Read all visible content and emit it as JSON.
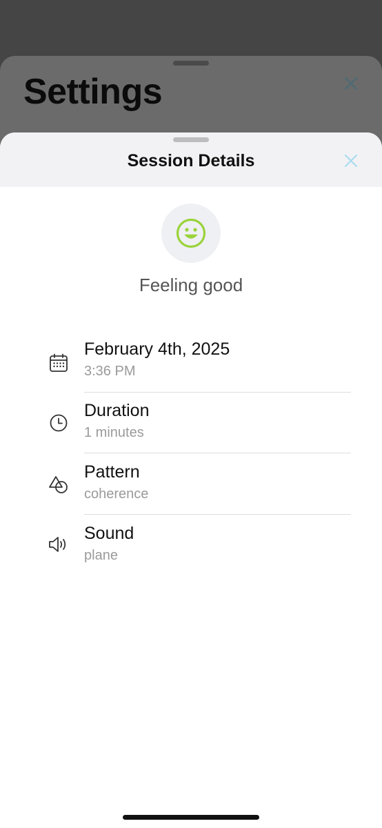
{
  "colors": {
    "accent": "#9ad33a",
    "close_front": "#a8dcef",
    "close_back": "#4b6a74"
  },
  "background_sheet": {
    "title": "Settings",
    "close_icon": "close-icon"
  },
  "session_sheet": {
    "title": "Session Details",
    "close_icon": "close-icon",
    "mood": {
      "icon": "smiley-icon",
      "label": "Feeling good"
    },
    "details": [
      {
        "icon": "calendar-icon",
        "title": "February 4th, 2025",
        "subtitle": "3:36 PM"
      },
      {
        "icon": "clock-icon",
        "title": "Duration",
        "subtitle": "1 minutes"
      },
      {
        "icon": "shapes-icon",
        "title": "Pattern",
        "subtitle": "coherence"
      },
      {
        "icon": "speaker-icon",
        "title": "Sound",
        "subtitle": "plane"
      }
    ]
  }
}
